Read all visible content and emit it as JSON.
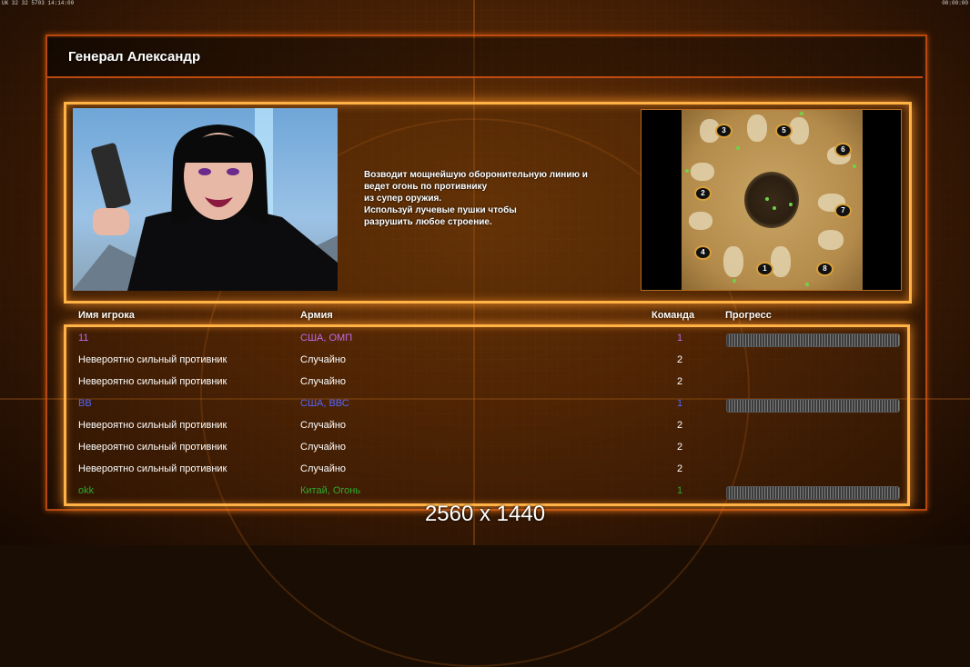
{
  "hud": {
    "left": "UK 32 32 5703 14:14:00",
    "right": "00:00:00"
  },
  "title": "Генерал Александр",
  "description": "Возводит мощнейшую оборонительную линию и\n ведет огонь по противнику\nиз супер оружия.\nИспользуй лучевые пушки чтобы\nразрушить любое строение.",
  "map": {
    "spawns": [
      "3",
      "5",
      "6",
      "2",
      "7",
      "4",
      "1",
      "8"
    ]
  },
  "columns": {
    "name": "Имя игрока",
    "army": "Армия",
    "team": "Команда",
    "progress": "Прогресс"
  },
  "players": [
    {
      "name": "11",
      "army": "США, ОМП",
      "team": "1",
      "color": "#c468e8",
      "has_progress": true,
      "progress": 1.0
    },
    {
      "name": "Невероятно сильный противник",
      "army": "Случайно",
      "team": "2",
      "color": "#ffffff",
      "has_progress": false
    },
    {
      "name": "Невероятно сильный противник",
      "army": "Случайно",
      "team": "2",
      "color": "#ffffff",
      "has_progress": false
    },
    {
      "name": "BB",
      "army": "США, ВВС",
      "team": "1",
      "color": "#5566ff",
      "has_progress": true,
      "progress": 1.0
    },
    {
      "name": "Невероятно сильный противник",
      "army": "Случайно",
      "team": "2",
      "color": "#ffffff",
      "has_progress": false
    },
    {
      "name": "Невероятно сильный противник",
      "army": "Случайно",
      "team": "2",
      "color": "#ffffff",
      "has_progress": false
    },
    {
      "name": "Невероятно сильный противник",
      "army": "Случайно",
      "team": "2",
      "color": "#ffffff",
      "has_progress": false
    },
    {
      "name": "okk",
      "army": "Китай, Огонь",
      "team": "1",
      "color": "#2fa92f",
      "has_progress": true,
      "progress": 1.0
    }
  ],
  "resolution_label": "2560 x 1440"
}
